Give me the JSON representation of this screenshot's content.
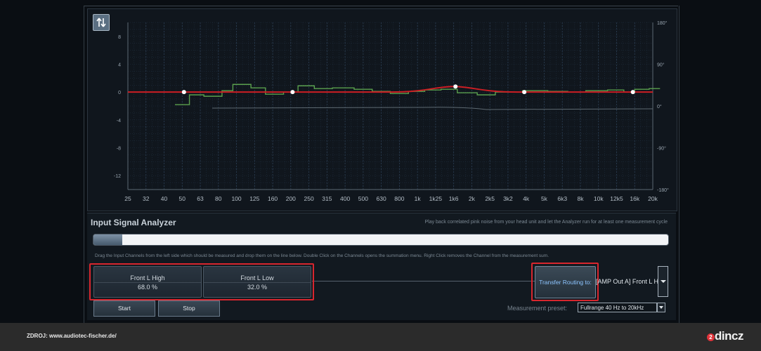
{
  "graph": {
    "y_ticks": [
      "8",
      "4",
      "0",
      "-4",
      "-8",
      "-12"
    ],
    "phase_ticks": [
      "180°",
      "90°",
      "0°",
      "-90°",
      "-180°"
    ],
    "x_ticks": [
      "25",
      "32",
      "40",
      "50",
      "63",
      "80",
      "100",
      "125",
      "160",
      "200",
      "250",
      "315",
      "400",
      "500",
      "630",
      "800",
      "1k",
      "1k25",
      "1k6",
      "2k",
      "2k5",
      "3k2",
      "4k",
      "5k",
      "6k3",
      "8k",
      "10k",
      "12k5",
      "16k",
      "20k"
    ],
    "swap_icon": "swap-vertical-icon",
    "colors": {
      "target_curve": "#cc1e24",
      "measured_curve": "#5aa04d",
      "phase_curve": "#5e6a72",
      "grid": "#233345"
    }
  },
  "analyzer": {
    "title": "Input Signal Analyzer",
    "hint": "Play back correlated pink noise from your head unit and let the Analyzer run for at least one measurement cycle",
    "progress": 0.05,
    "instructions": "Drag the Input Channels from the left side which should be measured and drop them on the line below. Double Click on the Channels opens the summation menu. Right Click removes the Channel from the measurement sum.",
    "channels": [
      {
        "name": "Front L High",
        "percent": "68.0 %"
      },
      {
        "name": "Front L Low",
        "percent": "32.0 %"
      }
    ],
    "routing": {
      "button_label": "Transfer Routing to:",
      "selected": "[AMP Out A] Front L H"
    },
    "buttons": {
      "start": "Start",
      "stop": "Stop"
    },
    "preset": {
      "label": "Measurement preset:",
      "selected": "Fullrange 40 Hz to 20kHz"
    }
  },
  "footer": {
    "source": "ZDROJ: www.audiotec-fischer.de/",
    "logo_badge": "2",
    "logo_text": "dincz"
  }
}
